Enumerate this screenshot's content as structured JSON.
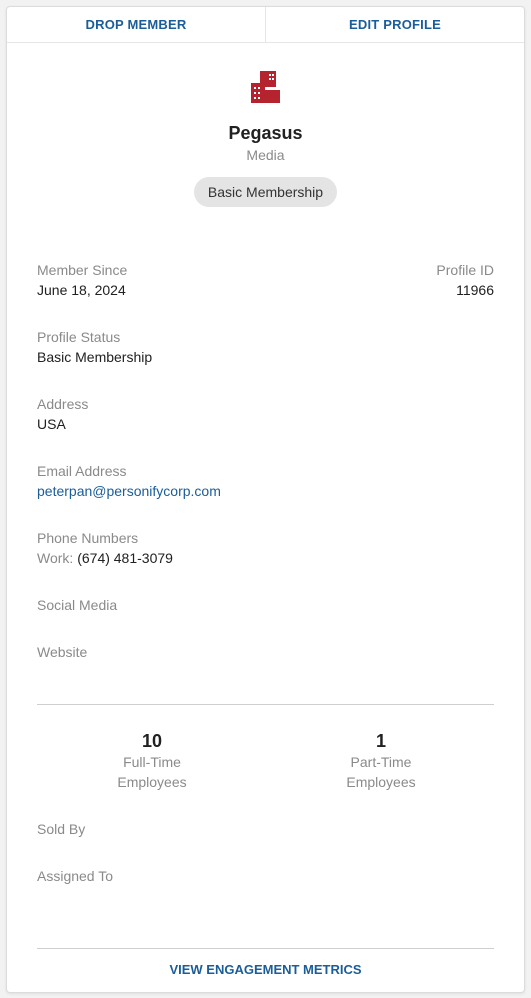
{
  "actions": {
    "drop_member": "DROP MEMBER",
    "edit_profile": "EDIT PROFILE",
    "view_metrics": "VIEW ENGAGEMENT METRICS"
  },
  "profile": {
    "name": "Pegasus",
    "type": "Media",
    "badge": "Basic Membership",
    "logo_icon": "buildings-icon",
    "logo_color": "#b5232f"
  },
  "fields": {
    "member_since_label": "Member Since",
    "member_since_value": "June 18, 2024",
    "profile_id_label": "Profile ID",
    "profile_id_value": "11966",
    "status_label": "Profile Status",
    "status_value": "Basic Membership",
    "address_label": "Address",
    "address_value": "USA",
    "email_label": "Email Address",
    "email_value": "peterpan@personifycorp.com",
    "phone_label": "Phone Numbers",
    "phone_type": "Work:",
    "phone_value": "(674) 481-3079",
    "social_label": "Social Media",
    "website_label": "Website",
    "sold_by_label": "Sold By",
    "assigned_to_label": "Assigned To"
  },
  "stats": {
    "full_time_count": "10",
    "full_time_line1": "Full-Time",
    "full_time_line2": "Employees",
    "part_time_count": "1",
    "part_time_line1": "Part-Time",
    "part_time_line2": "Employees"
  },
  "colors": {
    "accent": "#1a5d99",
    "muted_text": "#8a8a8a",
    "badge_bg": "#e4e4e4"
  }
}
